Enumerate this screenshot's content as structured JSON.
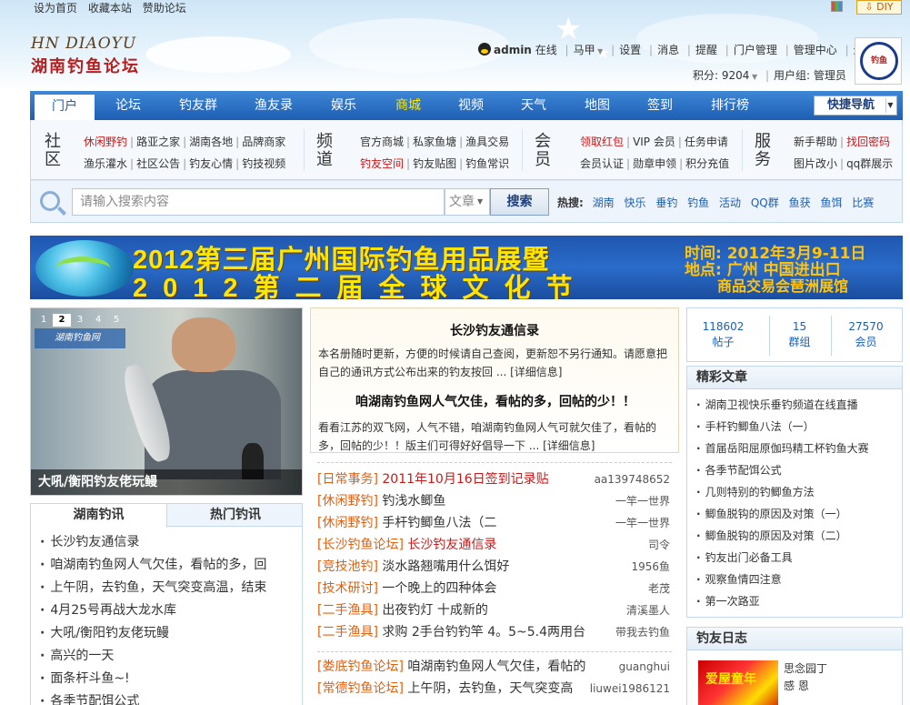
{
  "topbar": {
    "links": [
      "设为首页",
      "收藏本站",
      "赞助论坛"
    ],
    "diy_label": "DIY"
  },
  "logo": {
    "en": "HN DIAOYU",
    "cn": "湖南钓鱼论坛"
  },
  "user": {
    "name": "admin",
    "status": "在线",
    "items": [
      "马甲",
      "设置",
      "消息",
      "提醒",
      "门户管理",
      "管理中心",
      "退出"
    ],
    "points": "积分: 9204",
    "group": "用户组: 管理员"
  },
  "badge_text": "钓鱼",
  "nav": {
    "items": [
      "门户",
      "论坛",
      "钓友群",
      "渔友录",
      "娱乐",
      "商城",
      "视频",
      "天气",
      "地图",
      "签到",
      "排行榜"
    ],
    "active_index": 0,
    "quick_label": "快捷导航"
  },
  "subnav": {
    "groups": [
      {
        "title": "社区",
        "rows": [
          [
            "休闲野钓",
            "路亚之家",
            "湖南各地",
            "品牌商家"
          ],
          [
            "渔乐灌水",
            "社区公告",
            "钓友心情",
            "钓技视频"
          ]
        ]
      },
      {
        "title": "频道",
        "rows": [
          [
            "官方商城",
            "私家鱼塘",
            "渔具交易"
          ],
          [
            "钓友空间",
            "钓友贴图",
            "钓鱼常识"
          ]
        ]
      },
      {
        "title": "会员",
        "rows": [
          [
            "领取红包",
            "VIP 会员",
            "任务申请"
          ],
          [
            "会员认证",
            "勋章申领",
            "积分充值"
          ]
        ]
      },
      {
        "title": "服务",
        "rows": [
          [
            "新手帮助",
            "找回密码"
          ],
          [
            "图片改小",
            "qq群展示"
          ]
        ]
      }
    ]
  },
  "search": {
    "placeholder": "请输入搜索内容",
    "type": "文章",
    "button": "搜索",
    "hot_label": "热搜:",
    "hot": [
      "湖南",
      "快乐",
      "垂钓",
      "钓鱼",
      "活动",
      "QQ群",
      "鱼获",
      "鱼饵",
      "比赛"
    ]
  },
  "banner": {
    "line1": "2012第三届广州国际钓鱼用品展暨",
    "line2": "2012第二届全球文化节",
    "right1": "时间: 2012年3月9-11日",
    "right2": "地点: 广州 中国进出口",
    "right3": "商品交易会琶洲展馆"
  },
  "slide": {
    "nums": [
      "1",
      "2",
      "3",
      "4",
      "5"
    ],
    "active": 1,
    "site": "湖南钓鱼网",
    "caption": "大吼/衡阳钓友佬玩鳗"
  },
  "news_tabs": [
    "湖南钓讯",
    "热门钓讯"
  ],
  "news_list": [
    "长沙钓友通信录",
    "咱湖南钓鱼网人气欠佳，看帖的多，回",
    "上午阴，去钓鱼，天气突变高温，结束",
    "4月25号再战大龙水库",
    "大吼/衡阳钓友佬玩鳗",
    "高兴的一天",
    "面条杆斗鱼~!",
    "各季节配饵公式"
  ],
  "featured": {
    "title1": "长沙钓友通信录",
    "text1": "本名册随时更新，方便的时候请自己查阅，更新恕不另行通知。请愿意把自己的通讯方式公布出来的钓友按回 ... [详细信息]",
    "title2": "咱湖南钓鱼网人气欠佳，看帖的多，回帖的少！！",
    "text2": "看看江苏的双飞网，人气不错，咱湖南钓鱼网人气可就欠佳了，看帖的多，回帖的少！！版主们可得好好倡导一下 ... [详细信息]"
  },
  "threads": [
    {
      "cat": "[日常事务]",
      "title": "2011年10月16日签到记录贴",
      "author": "aa139748652",
      "red": true
    },
    {
      "cat": "[休闲野钓]",
      "title": "钓浅水鲫鱼",
      "author": "一竿一世界",
      "red": false
    },
    {
      "cat": "[休闲野钓]",
      "title": "手杆钓鲫鱼八法（二",
      "author": "一竿一世界",
      "red": false
    },
    {
      "cat": "[长沙钓鱼论坛]",
      "title": "长沙钓友通信录",
      "author": "司令",
      "red": true
    },
    {
      "cat": "[竞技池钓]",
      "title": "淡水路翘嘴用什么饵好",
      "author": "1956鱼",
      "red": false
    },
    {
      "cat": "[技术研讨]",
      "title": "一个晚上的四种体会",
      "author": "老茂",
      "red": false
    },
    {
      "cat": "[二手渔具]",
      "title": "出夜钓灯 十成新的",
      "author": "清溪墨人",
      "red": false
    },
    {
      "cat": "[二手渔具]",
      "title": "求购 2手台钓钓竿 4。5~5.4两用台",
      "author": "带我去钓鱼",
      "red": false
    }
  ],
  "threads2": [
    {
      "cat": "[娄底钓鱼论坛]",
      "title": "咱湖南钓鱼网人气欠佳，看帖的",
      "author": "guanghui"
    },
    {
      "cat": "[常德钓鱼论坛]",
      "title": "上午阴，去钓鱼，天气突变高",
      "author": "liuwei1986121"
    }
  ],
  "stats": [
    {
      "num": "118602",
      "label": "帖子"
    },
    {
      "num": "15",
      "label": "群组"
    },
    {
      "num": "27570",
      "label": "会员"
    }
  ],
  "articles_title": "精彩文章",
  "articles": [
    "湖南卫视快乐垂钓频道在线直播",
    "手杆钓鲫鱼八法（一）",
    "首届岳阳屈原伽玛精工杯钓鱼大赛",
    "各季节配饵公式",
    "几则特别的钓鲫鱼方法",
    "鲫鱼脱钩的原因及对策（一）",
    "鲫鱼脱钩的原因及对策（二）",
    "钓友出门必备工具",
    "观察鱼情四注意",
    "第一次路亚"
  ],
  "diary": {
    "title": "钓友日志",
    "pic_text": "爱屋童年",
    "line1": "思念园丁",
    "line2": "感 恩"
  },
  "colors": {
    "nav": "#1e5fb3",
    "accent_red": "#c81818",
    "category_orange": "#e06010"
  }
}
